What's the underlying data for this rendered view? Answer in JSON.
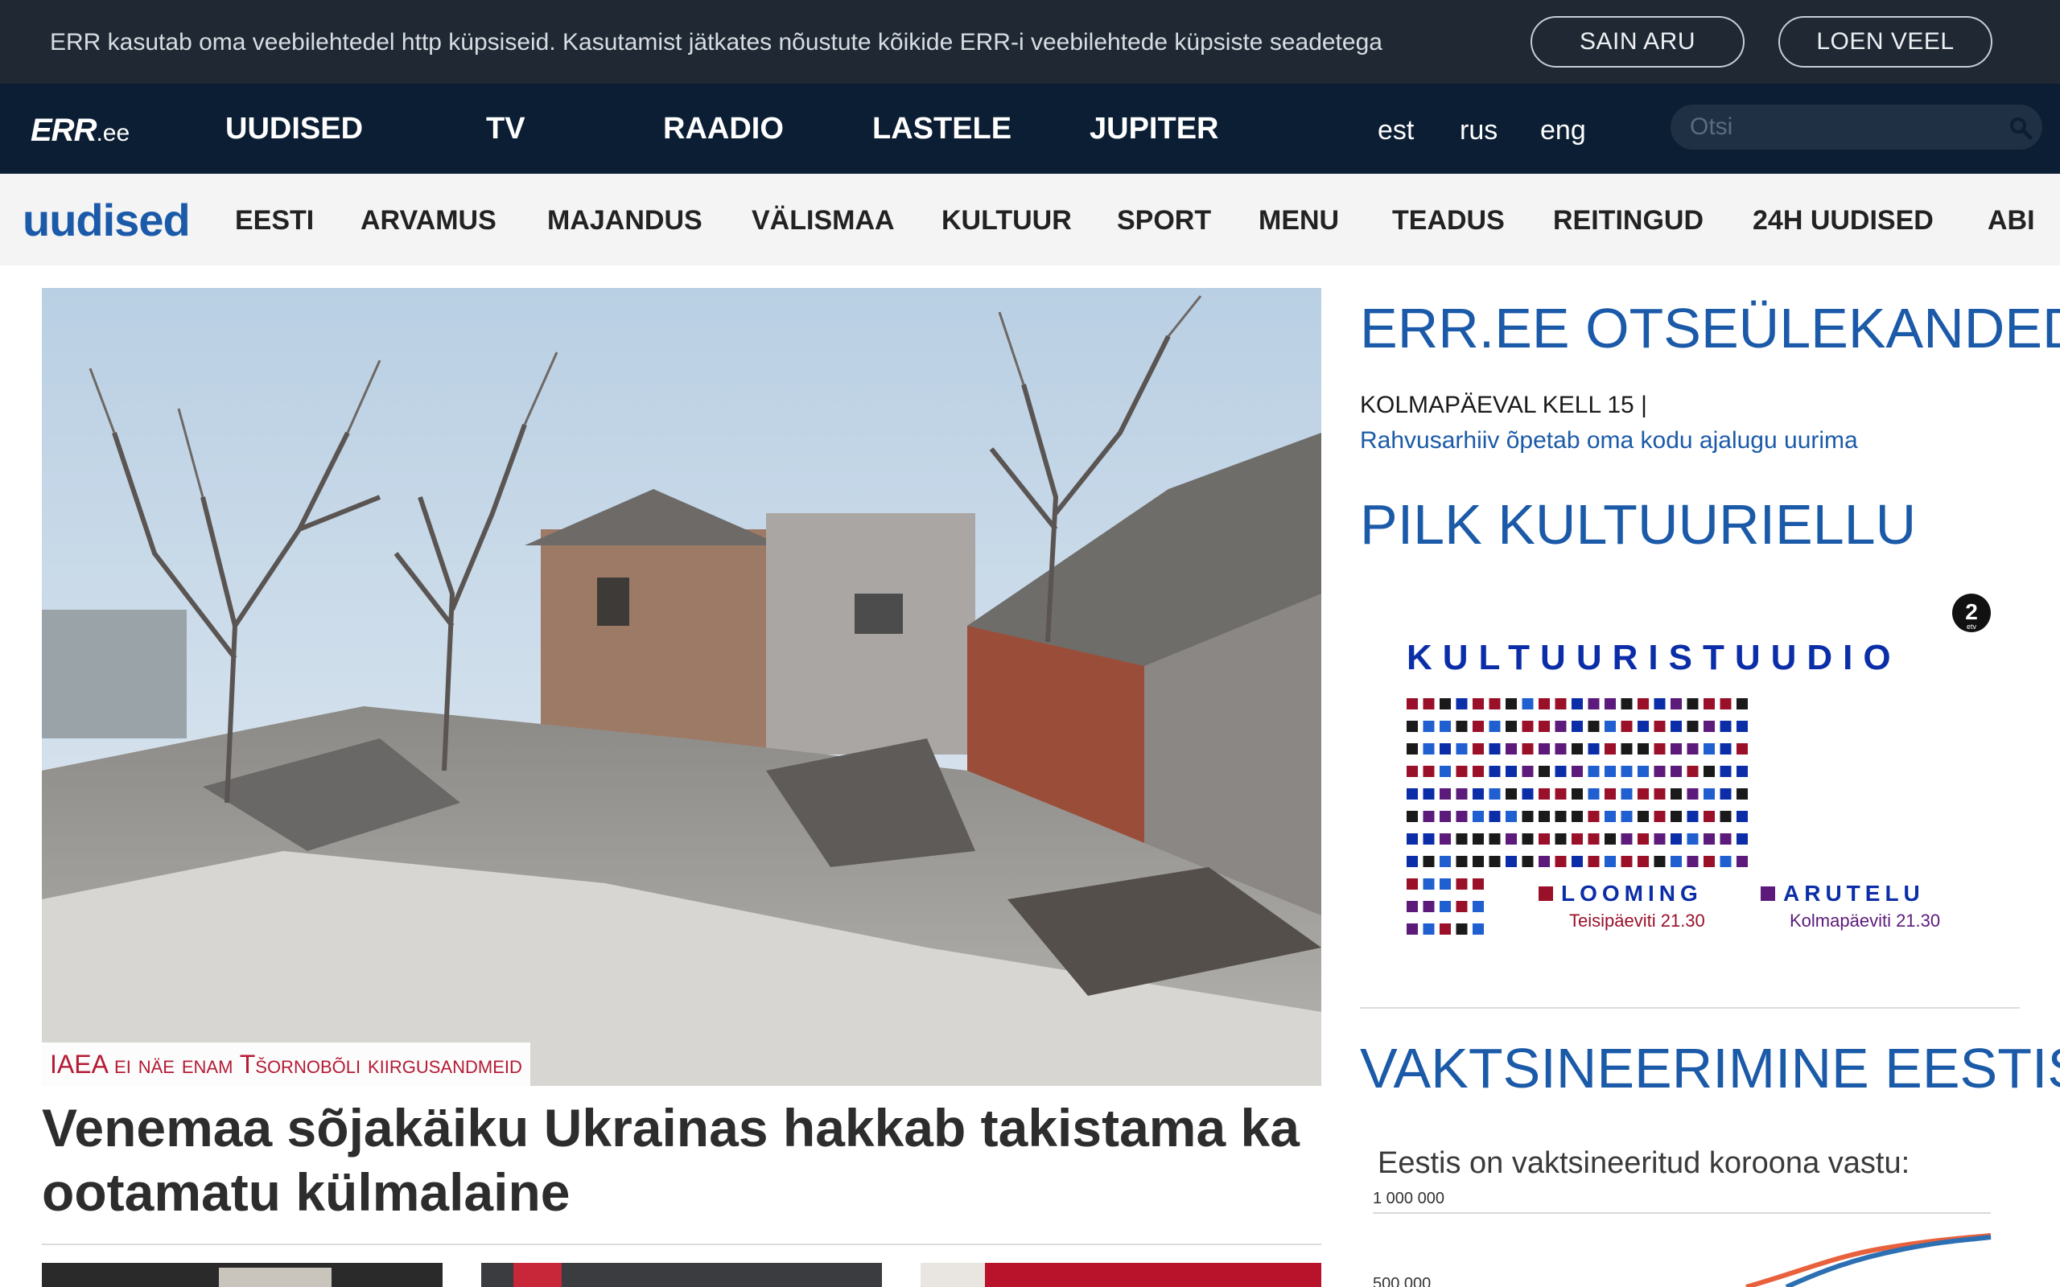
{
  "cookie_bar": {
    "text": "ERR kasutab oma veebilehtedel http küpsiseid. Kasutamist jätkates nõustute kõikide ERR-i veebilehtede küpsiste seadetega",
    "accept_label": "SAIN ARU",
    "more_label": "LOEN VEEL"
  },
  "top_nav": {
    "logo_main": "ERR",
    "logo_suffix": ".ee",
    "items": [
      "UUDISED",
      "TV",
      "RAADIO",
      "LASTELE",
      "JUPITER"
    ],
    "languages": [
      "est",
      "rus",
      "eng"
    ],
    "search_placeholder": "Otsi"
  },
  "sub_nav": {
    "section_name": "uudised",
    "items": [
      "EESTI",
      "ARVAMUS",
      "MAJANDUS",
      "VÄLISMAA",
      "KULTUUR",
      "SPORT",
      "MENU",
      "TEADUS",
      "REITINGUD",
      "24H UUDISED",
      "ABI"
    ]
  },
  "main_article": {
    "label": "IAEA ei näe enam Tšornobõli kiirgusandmeid",
    "headline": "Venemaa sõjakäiku Ukrainas hakkab takistama ka ootamatu külmalaine"
  },
  "sidebar": {
    "live_title": "ERR.EE OTSEÜLEKANDED",
    "live_when": "KOLMAPÄEVAL KELL 15 |",
    "live_link": "Rahvusarhiiv õpetab oma kodu ajalugu uurima",
    "culture_title": "PILK KULTUURIELLU",
    "banner": {
      "title": "KULTUURISTUUDIO",
      "channel_badge": "2",
      "channel_sub": "etv",
      "left_label": "LOOMING",
      "left_time": "Teisipäeviti 21.30",
      "right_label": "ARUTELU",
      "right_time": "Kolmapäeviti 21.30",
      "colors": [
        "#1a1a1a",
        "#0b2ea8",
        "#9a1029",
        "#5c1a7a",
        "#1f5fd0"
      ]
    },
    "vax_title": "VAKTSINEERIMINE EESTIS",
    "vax_subtitle": "Eestis on vaktsineeritud koroona vastu:",
    "vax_tick_top": "1 000 000",
    "vax_tick_mid": "500 000"
  },
  "colors": {
    "cookie_bg": "#202833",
    "nav_bg": "#0c1e33",
    "accent_blue": "#1b5aa8",
    "label_red": "#b51a34"
  }
}
